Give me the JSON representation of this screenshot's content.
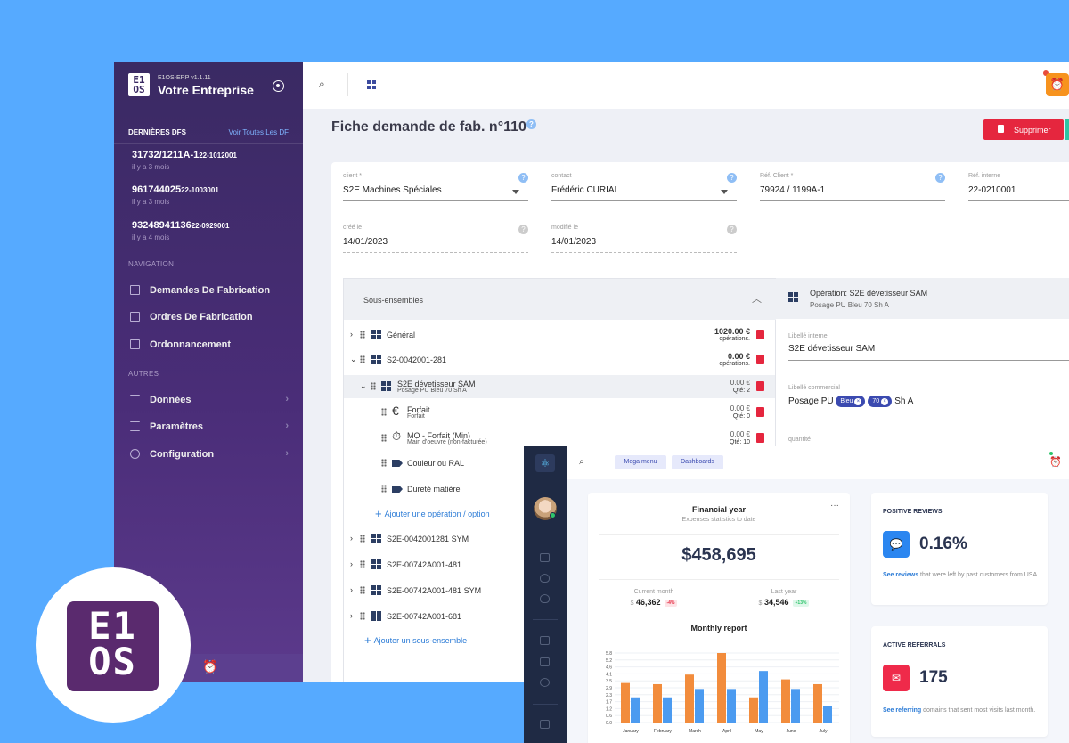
{
  "erp": {
    "app_version": "E1OS-ERP v1.1.11",
    "company": "Votre Entreprise",
    "logo_text_top": "E1",
    "logo_text_bottom": "OS",
    "recent": {
      "title": "DERNIÈRES DFS",
      "see_all": "Voir Toutes Les DF",
      "items": [
        {
          "code": "31732/1211A-1",
          "ref": "22-1012001",
          "time": "il y a 3 mois"
        },
        {
          "code": "961744025",
          "ref": "22-1003001",
          "time": "il y a 3 mois"
        },
        {
          "code": "93248941136",
          "ref": "22-0929001",
          "time": "il y a 4 mois"
        }
      ]
    },
    "nav_section": "NAVIGATION",
    "nav": [
      {
        "label": "Demandes De Fabrication",
        "icon": "clipboard-icon"
      },
      {
        "label": "Ordres De Fabrication",
        "icon": "calendar-icon"
      },
      {
        "label": "Ordonnancement",
        "icon": "calendar-icon"
      }
    ],
    "other_section": "AUTRES",
    "other": [
      {
        "label": "Données",
        "icon": "list-icon"
      },
      {
        "label": "Paramètres",
        "icon": "sliders-icon"
      },
      {
        "label": "Configuration",
        "icon": "gear-icon"
      }
    ],
    "page_title": "Fiche demande de fab. n°110",
    "delete_label": "Supprimer",
    "fields": {
      "client": {
        "label": "client *",
        "value": "S2E Machines Spéciales"
      },
      "contact": {
        "label": "contact",
        "value": "Frédéric CURIAL"
      },
      "ref_client": {
        "label": "Réf. Client *",
        "value": "79924 / 1199A-1"
      },
      "ref_interne": {
        "label": "Réf. interne",
        "value": "22-0210001"
      },
      "created": {
        "label": "créé le",
        "value": "14/01/2023"
      },
      "modified": {
        "label": "modifié le",
        "value": "14/01/2023"
      }
    },
    "sous_ensembles": {
      "title": "Sous-ensembles",
      "general": {
        "label": "Général",
        "amount": "1020.00 €",
        "sub": "opérations."
      },
      "s2": {
        "label": "S2-0042001-281",
        "amount": "0.00 €",
        "sub": "opérations."
      },
      "op": {
        "label": "S2E dévetisseur SAM",
        "sub_label": "Posage PU Bleu 70 Sh A",
        "amount": "0.00 €",
        "sub": "Qté: 2"
      },
      "forfait": {
        "label": "Forfait",
        "sub_label": "Forfait",
        "amount": "0.00 €",
        "sub": "Qté: 0"
      },
      "mo": {
        "label": "MO - Forfait (Min)",
        "sub_label": "Main d'oeuvre (non-facturée)",
        "amount": "0.00 €",
        "sub": "Qté: 10"
      },
      "couleur": "Couleur ou RAL",
      "durete": "Dureté matière",
      "add_operation": "Ajouter une opération / option",
      "others": [
        "S2E-0042001281 SYM",
        "S2E-00742A001-481",
        "S2E-00742A001-481 SYM",
        "S2E-00742A001-681"
      ],
      "add_sub": "Ajouter un sous-ensemble"
    },
    "operation": {
      "title": "Opération: S2E dévetisseur SAM",
      "subtitle": "Posage PU Bleu 70 Sh A",
      "libelle_interne_label": "Libellé interne",
      "libelle_interne": "S2E dévetisseur SAM",
      "libelle_commercial_label": "Libellé commercial",
      "commercial_prefix": "Posage PU",
      "chip1": "Bleu",
      "chip2": "70",
      "commercial_suffix": "Sh A",
      "quantite_label": "quantité"
    }
  },
  "dashboard": {
    "mega_menu": "Mega menu",
    "dashboards": "Dashboards",
    "financial": {
      "title": "Financial year",
      "subtitle": "Expenses statistics to date",
      "total": "$458,695",
      "current_label": "Current month",
      "current_currency": "$",
      "current_value": "46,362",
      "current_badge": "-4%",
      "last_label": "Last year",
      "last_currency": "$",
      "last_value": "34,546",
      "last_badge": "+13%",
      "monthly_title": "Monthly report"
    },
    "positive": {
      "title": "POSITIVE REVIEWS",
      "value": "0.16%",
      "link": "See reviews",
      "text": " that were left by past customers from USA."
    },
    "referrals": {
      "title": "ACTIVE REFERRALS",
      "value": "175",
      "link": "See referring",
      "text": " domains that sent most visits last month."
    },
    "colors": {
      "orange": "#f28c3c",
      "blue": "#4c9bf0",
      "positive_icon": "#2b86f0",
      "referral_icon": "#ef2a4a"
    }
  },
  "chart_data": {
    "type": "bar",
    "title": "Monthly report",
    "categories": [
      "January",
      "February",
      "March",
      "April",
      "May",
      "June",
      "July"
    ],
    "yticks": [
      "5.8",
      "5.2",
      "4.6",
      "4.1",
      "3.5",
      "2.9",
      "2.3",
      "1.7",
      "1.2",
      "0.6",
      "0.0"
    ],
    "ylim": [
      0,
      5.8
    ],
    "series": [
      {
        "values": [
          3.3,
          3.2,
          4.0,
          5.8,
          2.1,
          3.6,
          3.2
        ]
      },
      {
        "values": [
          2.1,
          2.1,
          2.8,
          2.8,
          4.3,
          2.8,
          1.4
        ]
      }
    ]
  }
}
